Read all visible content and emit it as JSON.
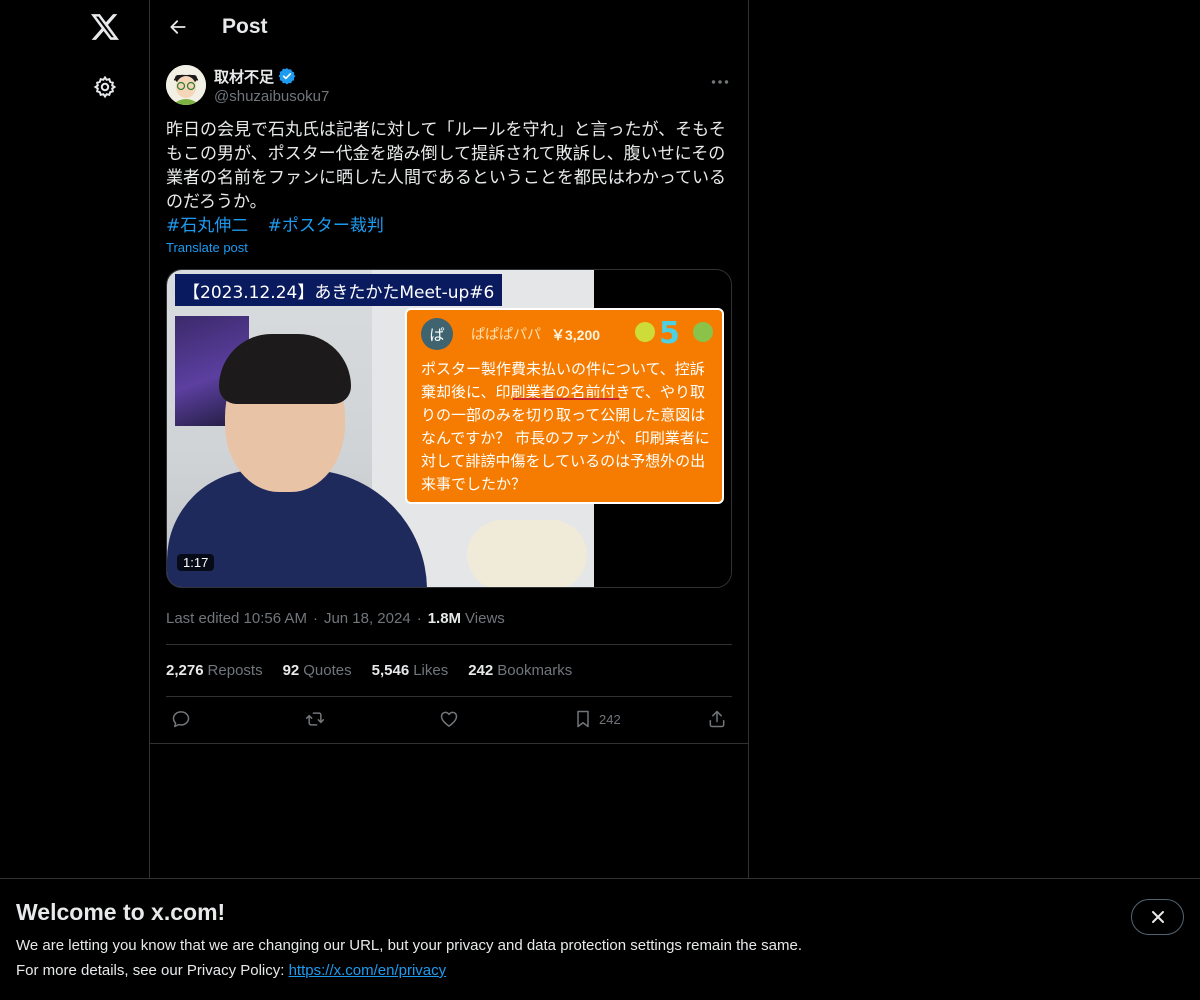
{
  "nav": {
    "logo_icon": "x-logo-icon",
    "settings_icon": "gear-icon"
  },
  "header": {
    "title": "Post"
  },
  "post": {
    "author": {
      "name": "取材不足",
      "handle": "@shuzaibusoku7",
      "verified": true
    },
    "text": "昨日の会見で石丸氏は記者に対して「ルールを守れ」と言ったが、そもそもこの男が、ポスター代金を踏み倒して提訴されて敗訴し、腹いせにその業者の名前をファンに晒した人間であるということを都民はわかっているのだろうか。",
    "hashtags": [
      "#石丸伸二",
      "#ポスター裁判"
    ],
    "translate_label": "Translate post",
    "media": {
      "video_title": "【2023.12.24】あきたかたMeet-up#6",
      "duration": "1:17",
      "superchat": {
        "avatar_letter": "ぱ",
        "name": "ぱぱぱパパ",
        "amount": "￥3,200",
        "badge": "5",
        "message": "ポスター製作費未払いの件について、控訴棄却後に、印刷業者の名前付きで、やり取りの一部のみを切り取って公開した意図はなんですか？ 市長のファンが、印刷業者に対して誹謗中傷をしているのは予想外の出来事でしたか？"
      }
    },
    "meta": {
      "edited": "Last edited 10:56 AM",
      "date": "Jun 18, 2024",
      "views_count": "1.8M",
      "views_label": "Views",
      "separator": "·"
    },
    "stats": [
      {
        "count": "2,276",
        "label": "Reposts"
      },
      {
        "count": "92",
        "label": "Quotes"
      },
      {
        "count": "5,546",
        "label": "Likes"
      },
      {
        "count": "242",
        "label": "Bookmarks"
      }
    ],
    "actions": {
      "reply_icon": "reply-icon",
      "repost_icon": "repost-icon",
      "like_icon": "heart-icon",
      "bookmark_icon": "bookmark-icon",
      "bookmark_count": "242",
      "share_icon": "share-icon"
    }
  },
  "banner": {
    "title": "Welcome to x.com!",
    "line1": "We are letting you know that we are changing our URL, but your privacy and data protection settings remain the same.",
    "line2_prefix": "For more details, see our Privacy Policy: ",
    "link": "https://x.com/en/privacy"
  },
  "colors": {
    "background": "#000000",
    "text": "#e7e9ea",
    "muted": "#71767b",
    "accent": "#1d9bf0",
    "border": "#2f3336"
  }
}
